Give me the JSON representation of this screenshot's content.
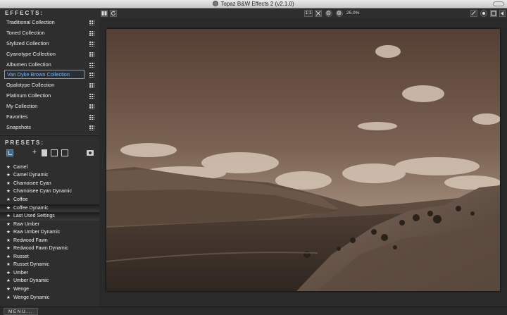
{
  "window": {
    "title": "Topaz B&W Effects 2 (v2.1.0)"
  },
  "effects": {
    "header": "EFFECTS:",
    "items": [
      "Traditional Collection",
      "Toned Collection",
      "Stylized Collection",
      "Cyanotype Collection",
      "Albumen Collection",
      "Van Dyke Brown Collection",
      "Opalotype Collection",
      "Platinum Collection",
      "My Collection",
      "Favorites",
      "Snapshots"
    ],
    "selected": "Van Dyke Brown Collection"
  },
  "presets": {
    "header": "PRESETS:",
    "items": [
      "Camel",
      "Camel Dynamic",
      "Chamoisee Cyan",
      "Chamoisee Cyan Dynamic",
      "Coffee",
      "Coffee Dynamic",
      "Last Used Settings",
      "Raw Umber",
      "Raw Umber Dynamic",
      "Redwood Fawn",
      "Redwood Fawn Dynamic",
      "Russet",
      "Russet Dynamic",
      "Umber",
      "Umber Dynamic",
      "Wenge",
      "Wenge Dynamic"
    ],
    "highlighted": [
      "Coffee Dynamic",
      "Last Used Settings"
    ],
    "star_glyph": "★"
  },
  "toolbar": {
    "zoom_1to1": "1:1",
    "zoom_value": "25.0%"
  },
  "bottom": {
    "menu_label": "MENU..."
  },
  "colors": {
    "panel": "#2e2e2e",
    "selected_text": "#6fb3ff",
    "sepia_sky": "#6b5447",
    "sepia_land": "#5a4a3e"
  },
  "icons": {
    "split_view": "split-view-icon",
    "refresh": "refresh-icon",
    "zoom_in": "zoom-in-icon",
    "zoom_out": "zoom-out-icon",
    "fit": "fit-to-window-icon"
  }
}
